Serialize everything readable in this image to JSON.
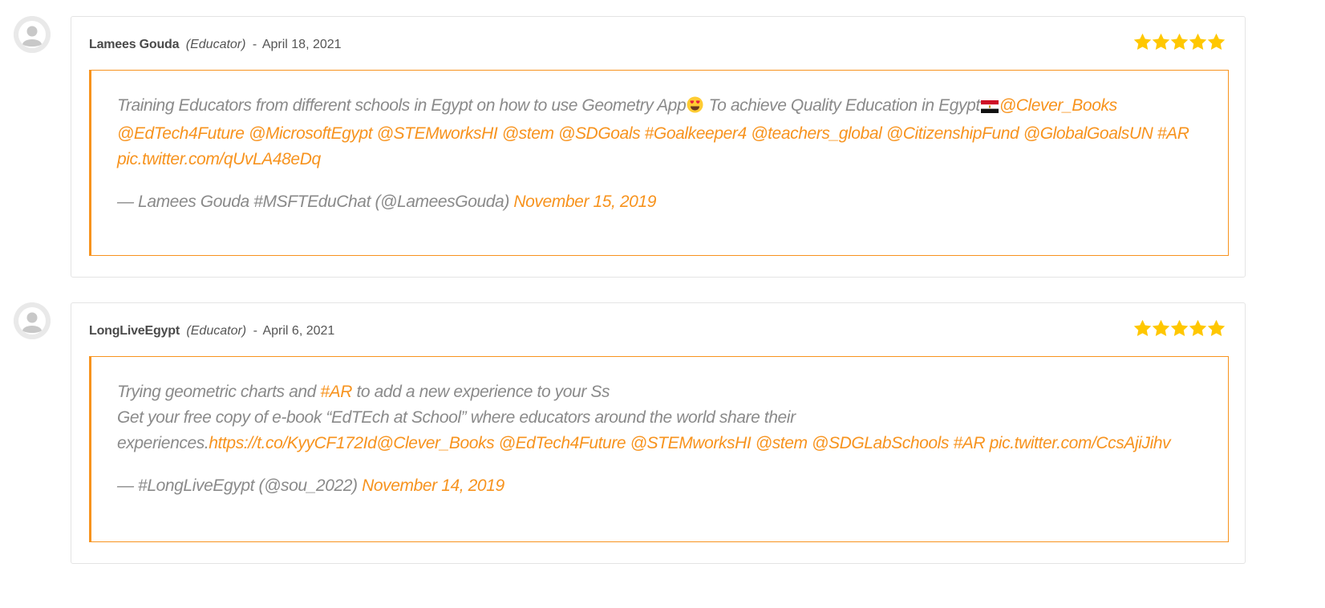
{
  "colors": {
    "accent": "#f7931e",
    "star": "#ffc700",
    "border": "#e4e4e4",
    "muted_text": "#8a8a8a"
  },
  "reviews": [
    {
      "author": "Lamees Gouda",
      "role": "(Educator)",
      "separator": "-",
      "date": "April 18, 2021",
      "rating": 5,
      "quote": {
        "t1": "Training Educators from different schools in Egypt on how to use Geometry App",
        "emoji1": "smiling-face-with-heart-eyes-icon",
        "t2": " To achieve Quality Education in Egypt",
        "emoji2": "egypt-flag-icon",
        "l1": "@Clever_Books",
        "l2": "@EdTech4Future",
        "l3": "@MicrosoftEgypt",
        "l4": "@STEMworksHI",
        "l5": "@stem",
        "l6": "@SDGoals",
        "l7": "#Goalkeeper4",
        "l8": "@teachers_global",
        "l9": "@CitizenshipFund",
        "l10": "@GlobalGoalsUN",
        "l11": "#AR",
        "l12": "pic.twitter.com/qUvLA48eDq",
        "attribution": "— Lamees Gouda #MSFTEduChat (@LameesGouda)",
        "attribution_date": "November 15, 2019"
      }
    },
    {
      "author": "LongLiveEgypt",
      "role": "(Educator)",
      "separator": "-",
      "date": "April 6, 2021",
      "rating": 5,
      "quote": {
        "t1": "Trying geometric charts and ",
        "l1": "#AR",
        "t2": " to add a new experience to your Ss",
        "t3": "Get your free copy of e-book “EdTEch at School” where educators around the world share their",
        "t4": "experiences.",
        "l2": "https://t.co/KyyCF172Id",
        "l3": "@Clever_Books",
        "l4": "@EdTech4Future",
        "l5": "@STEMworksHI",
        "l6": "@stem",
        "l7": "@SDGLabSchools",
        "l8": "#AR",
        "l9": "pic.twitter.com/CcsAjiJihv",
        "attribution": "— #LongLiveEgypt (@sou_2022)",
        "attribution_date": "November 14, 2019"
      }
    }
  ]
}
